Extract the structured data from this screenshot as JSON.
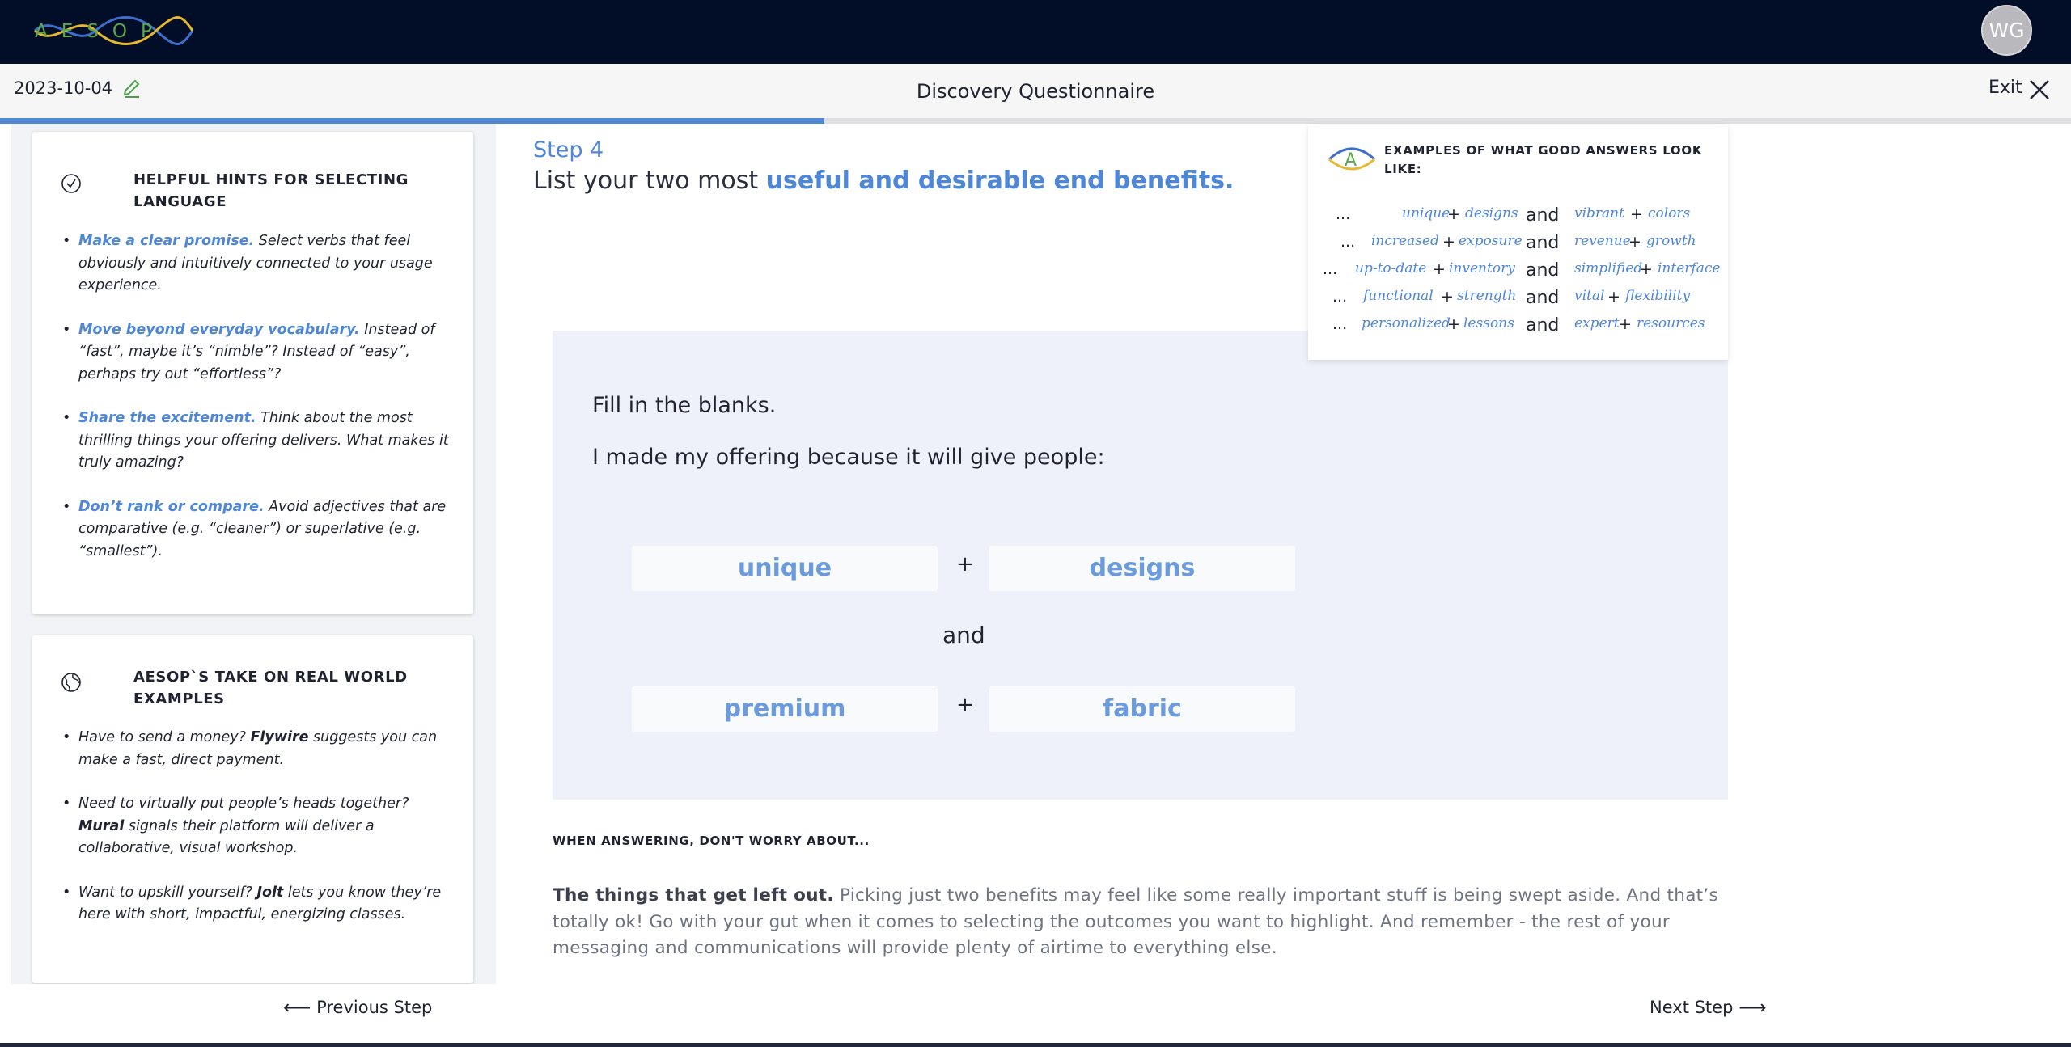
{
  "app": {
    "logo_text": "AESOP",
    "user_initials": "WG",
    "date": "2023-10-04",
    "page_title": "Discovery Questionnaire",
    "exit_label": "Exit",
    "progress_fraction": 0.398
  },
  "sidebar": {
    "hints": {
      "title": "HELPFUL HINTS FOR SELECTING LANGUAGE",
      "items": [
        {
          "lead": "Make a clear promise.",
          "text": " Select verbs that feel obviously and intuitively connected to your usage experience."
        },
        {
          "lead": "Move beyond everyday vocabulary.",
          "text": " Instead of “fast”, maybe it’s “nimble”? Instead of “easy”, perhaps try out “effortless”?"
        },
        {
          "lead": "Share the excitement.",
          "text": " Think about the most thrilling things your offering delivers. What makes it truly amazing?"
        },
        {
          "lead": "Don’t rank or compare.",
          "text": " Avoid adjectives that are comparative (e.g. “cleaner”) or superlative (e.g. “smallest”)."
        }
      ]
    },
    "examples": {
      "title": "AESOP`S TAKE ON REAL WORLD EXAMPLES",
      "items": [
        {
          "pre": "Have to send a money? ",
          "brand": "Flywire",
          "post": " suggests you can make a fast, direct payment."
        },
        {
          "pre": "Need to virtually put people’s heads together? ",
          "brand": "Mural",
          "post": " signals their platform will deliver a collaborative, visual workshop."
        },
        {
          "pre": "Want to upskill yourself? ",
          "brand": "Jolt",
          "post": " lets you know they’re here with short, impactful, energizing classes."
        }
      ]
    }
  },
  "nav": {
    "prev_label": "Previous Step",
    "next_label": "Next Step"
  },
  "step": {
    "label": "Step 4",
    "question_prefix": "List your two most ",
    "question_emphasis": "useful and desirable end benefits."
  },
  "examples_panel": {
    "title": "EXAMPLES OF WHAT GOOD ANSWERS LOOK LIKE:",
    "rows": [
      {
        "a1": "unique",
        "a2": "designs",
        "b1": "vibrant",
        "b2": "colors"
      },
      {
        "a1": "increased",
        "a2": "exposure",
        "b1": "revenue",
        "b2": "growth"
      },
      {
        "a1": "up-to-date",
        "a2": "inventory",
        "b1": "simplified",
        "b2": "interface"
      },
      {
        "a1": "functional",
        "a2": "strength",
        "b1": "vital",
        "b2": "flexibility"
      },
      {
        "a1": "personalized",
        "a2": "lessons",
        "b1": "expert",
        "b2": "resources"
      }
    ],
    "ellipsis": "...",
    "plus": "+",
    "and": "and"
  },
  "fill": {
    "title": "Fill in the blanks.",
    "prompt": "I made my offering because it will give people:",
    "blank1": "unique",
    "blank2": "designs",
    "blank3": "premium",
    "blank4": "fabric",
    "plus": "+",
    "and": "and"
  },
  "worry": {
    "label": "WHEN ANSWERING, DON'T WORRY ABOUT...",
    "lead": "The things that get left out.",
    "text": " Picking just two benefits may feel like some really important stuff is being swept aside. And that’s totally ok! Go with your gut when it comes to selecting the outcomes you want to highlight. And remember - the rest of your messaging and communications will provide plenty of airtime to everything else."
  },
  "colors": {
    "nav_bg": "#020d27",
    "accent": "#4e87d6",
    "fill_bg": "#eef1f9"
  }
}
